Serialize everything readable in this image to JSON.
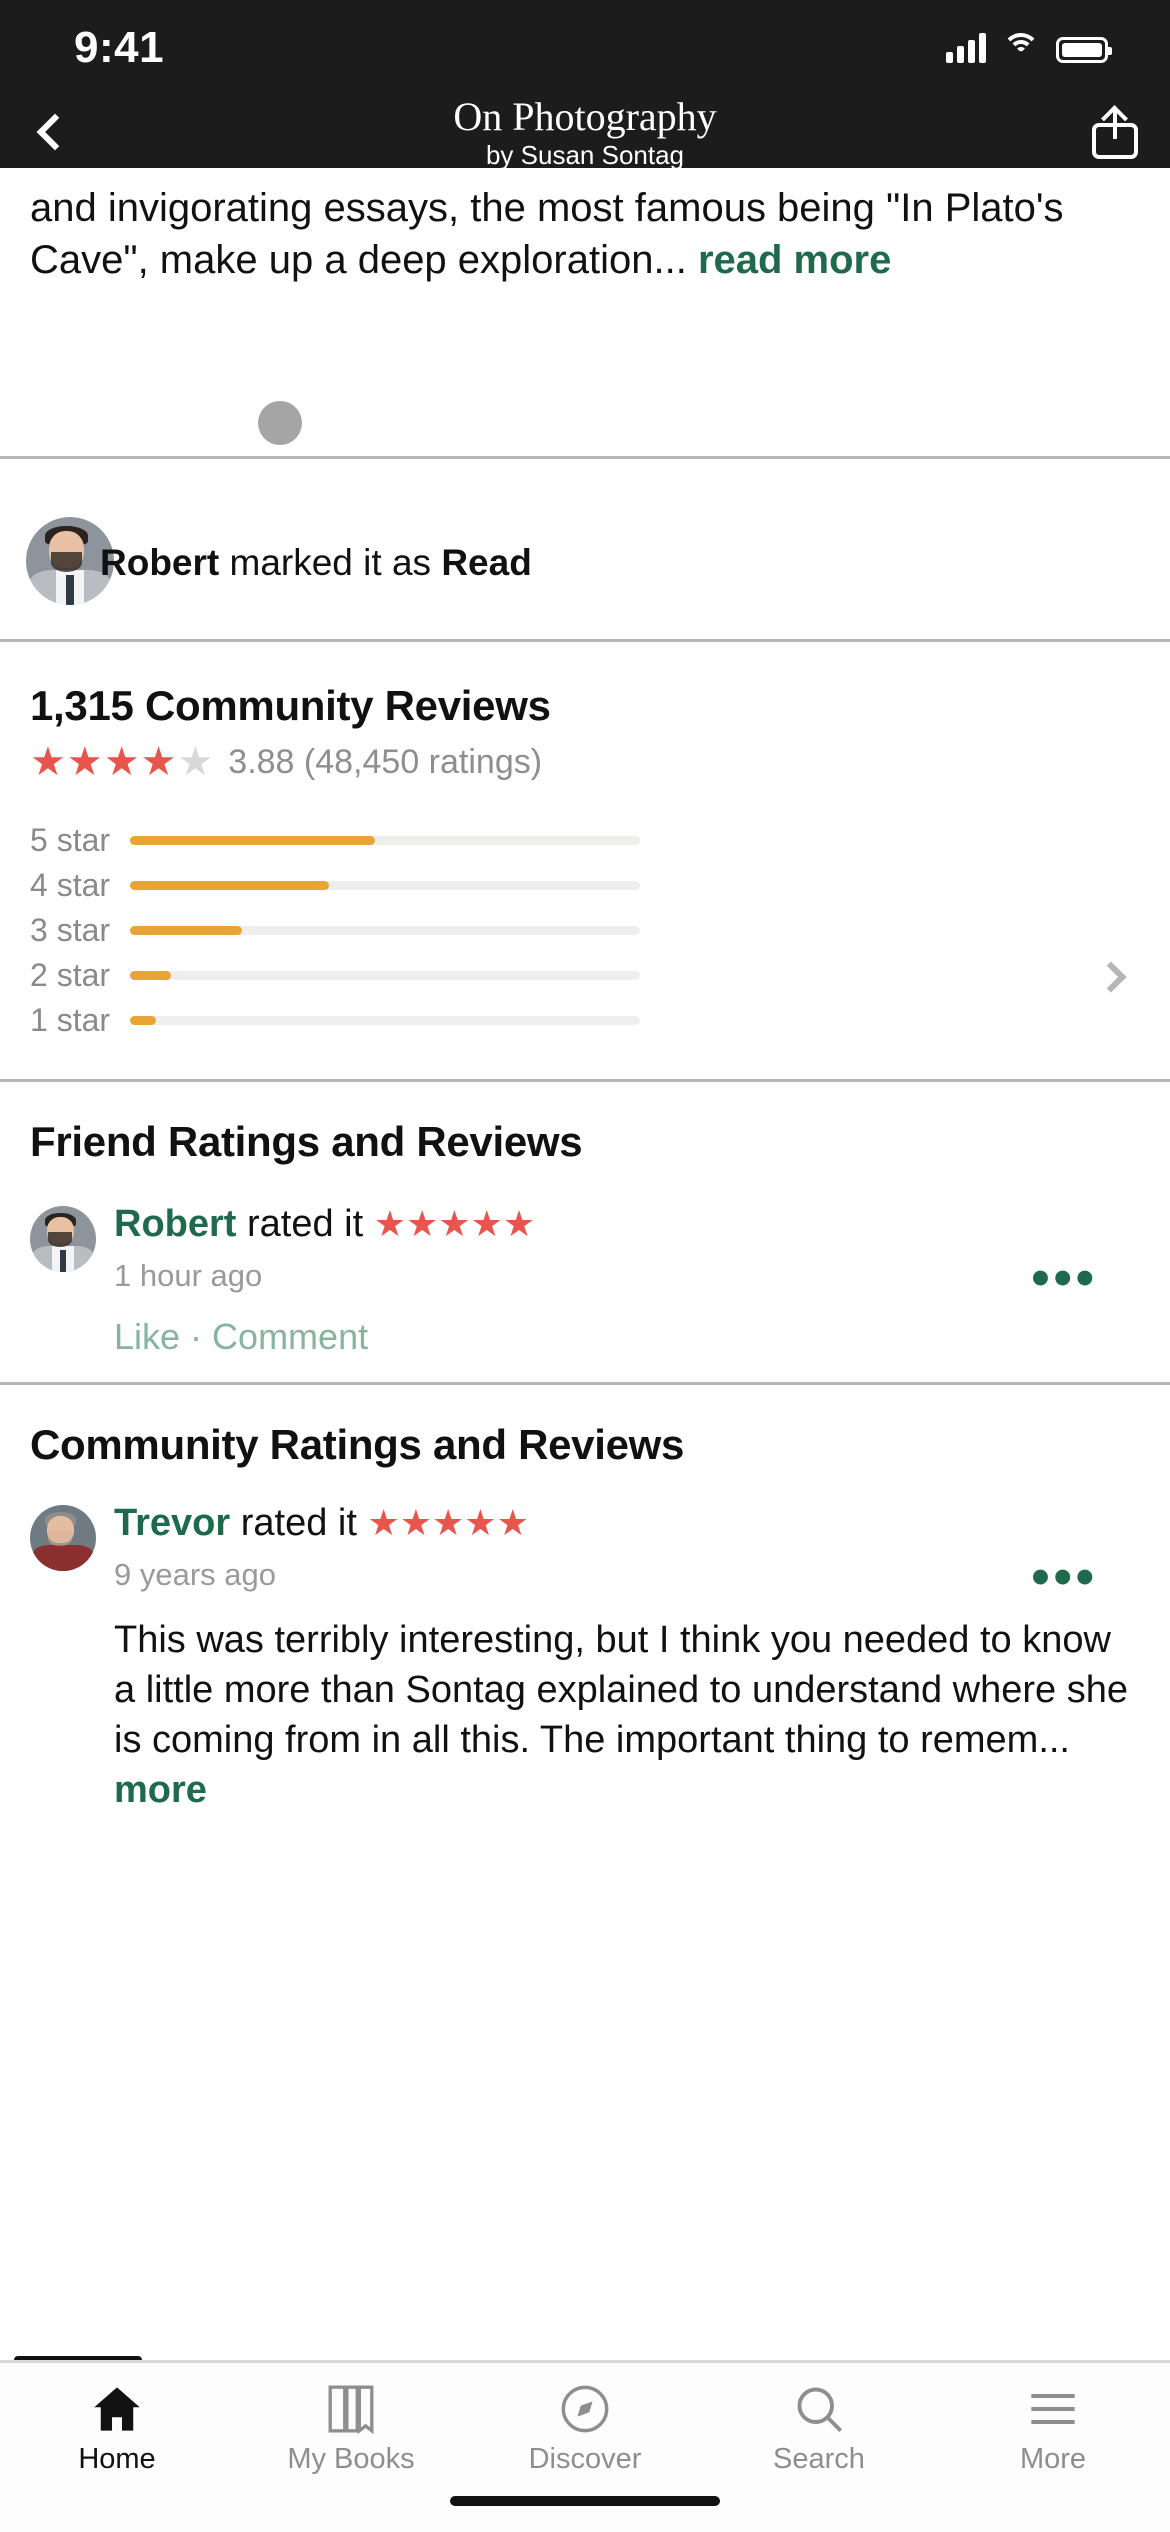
{
  "status_bar": {
    "time": "9:41",
    "cellular_icon": "signal-bars-icon",
    "wifi_icon": "wifi-icon",
    "battery_icon": "battery-icon"
  },
  "nav": {
    "back_icon": "back-chevron-icon",
    "title": "On Photography",
    "subtitle": "by Susan Sontag",
    "share_icon": "share-icon"
  },
  "description": {
    "text": "and invigorating essays, the most famous being \"In Plato's Cave\", make up a deep exploration...",
    "read_more": "read more"
  },
  "update": {
    "avatar": "robert-avatar",
    "name": "Robert",
    "middle": " marked it as ",
    "action": "Read"
  },
  "community": {
    "heading": "1,315 Community Reviews",
    "stars_filled": "★★★★",
    "stars_empty": "★",
    "rating_text": "3.88 (48,450 ratings)",
    "chevron_icon": "chevron-right-icon"
  },
  "chart_data": {
    "type": "bar",
    "title": "Rating distribution",
    "categories": [
      "5 star",
      "4 star",
      "3 star",
      "2 star",
      "1 star"
    ],
    "values": [
      48,
      39,
      22,
      8,
      5
    ],
    "xlabel": "",
    "ylabel": "",
    "xlim": [
      0,
      100
    ],
    "grid": false,
    "legend": "none",
    "orientation": "horizontal",
    "bar_color": "#eaa436",
    "track_color": "#eeeeec"
  },
  "friend_section": {
    "heading": "Friend Ratings and Reviews",
    "review": {
      "avatar": "robert-avatar",
      "name": "Robert",
      "verb": " rated it ",
      "stars": "★★★★★",
      "time": "1 hour ago",
      "like": "Like",
      "sep": " · ",
      "comment": "Comment",
      "menu_icon": "more-options-icon"
    }
  },
  "community_section": {
    "heading": "Community Ratings and Reviews",
    "review": {
      "avatar": "trevor-avatar",
      "name": "Trevor",
      "verb": " rated it ",
      "stars": "★★★★★",
      "time": "9 years ago",
      "body": "This was terribly interesting, but I think you needed to know a little more than Sontag explained to understand where she is coming from in all this. The important thing to remem...",
      "more": "more",
      "menu_icon": "more-options-icon"
    }
  },
  "tabbar": {
    "items": [
      {
        "label": "Home",
        "icon": "home-icon",
        "active": true
      },
      {
        "label": "My Books",
        "icon": "books-icon",
        "active": false
      },
      {
        "label": "Discover",
        "icon": "compass-icon",
        "active": false
      },
      {
        "label": "Search",
        "icon": "search-icon",
        "active": false
      },
      {
        "label": "More",
        "icon": "menu-icon",
        "active": false
      }
    ]
  },
  "colors": {
    "accent_green": "#1f6a4e",
    "star_red": "#e8554d",
    "bar_orange": "#eaa436",
    "muted": "#8e8e8e"
  }
}
